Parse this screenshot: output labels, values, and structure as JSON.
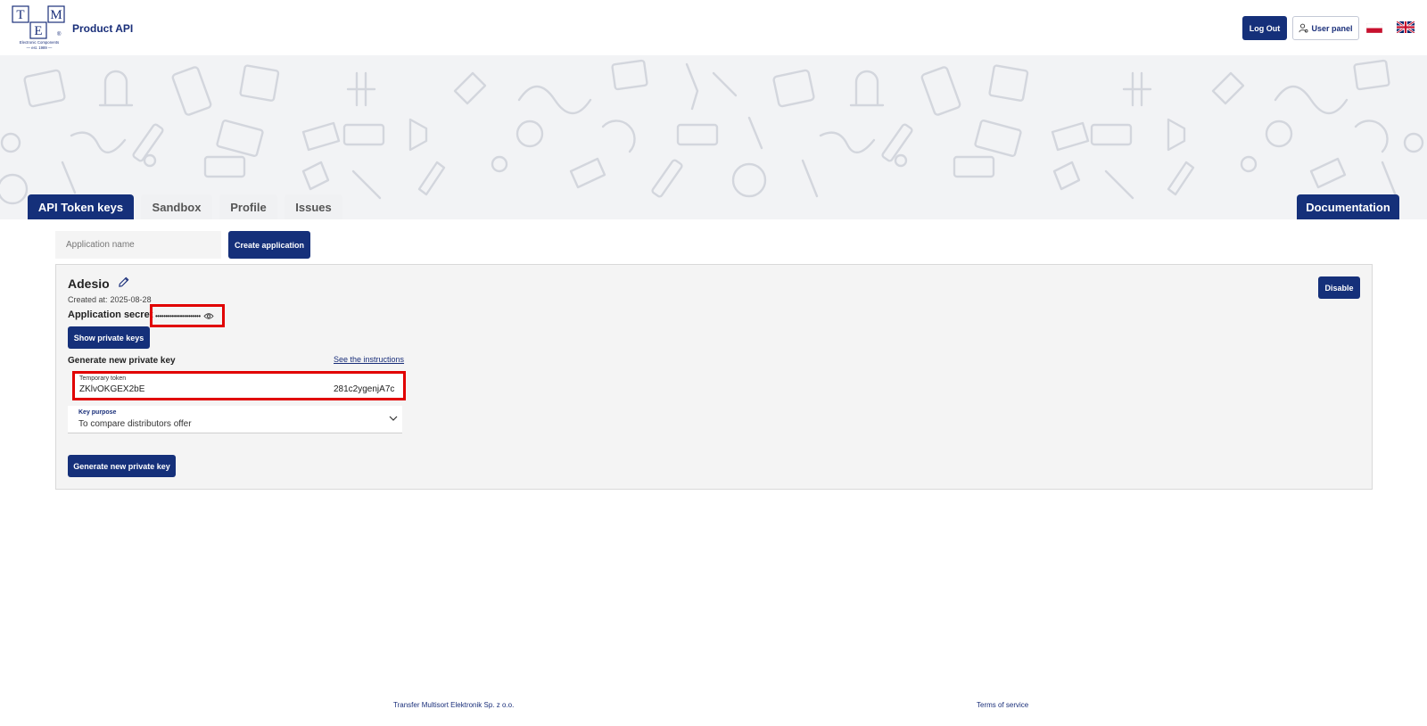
{
  "header": {
    "product_title": "Product API",
    "logout_label": "Log Out",
    "user_panel_label": "User panel",
    "logo": {
      "letters": [
        "T",
        "M",
        "E"
      ],
      "registered": "®",
      "tagline": "Electronic Components",
      "est": "— est. 1989 —"
    },
    "languages": [
      "pl-flag-icon",
      "uk-flag-icon"
    ]
  },
  "tabs": [
    {
      "label": "API Token keys",
      "active": true
    },
    {
      "label": "Sandbox",
      "active": false
    },
    {
      "label": "Profile",
      "active": false
    },
    {
      "label": "Issues",
      "active": false
    }
  ],
  "documentation_label": "Documentation",
  "create": {
    "placeholder": "Application name",
    "button_label": "Create application"
  },
  "application": {
    "name": "Adesio",
    "created_label": "Created at:",
    "created_date": "2025-08-28",
    "secret_label": "Application secret",
    "secret_masked": "••••••••••••••••••••••",
    "show_keys_label": "Show private keys",
    "generate_heading": "Generate new private key",
    "instructions_link": "See the instructions",
    "temp_token_label": "Temporary token",
    "temp_token_start": "ZKlvOKGEX2bE",
    "temp_token_end": "281c2ygenjA7c",
    "key_purpose_label": "Key purpose",
    "key_purpose_value": "To compare distributors offer",
    "generate_button_label": "Generate new private key",
    "disable_label": "Disable"
  },
  "footer": {
    "company": "Transfer Multisort Elektronik Sp. z o.o.",
    "terms": "Terms of service"
  },
  "colors": {
    "primary": "#15307a",
    "highlight": "#e10000",
    "banner_bg": "#f2f3f5",
    "panel_bg": "#f4f4f4"
  }
}
